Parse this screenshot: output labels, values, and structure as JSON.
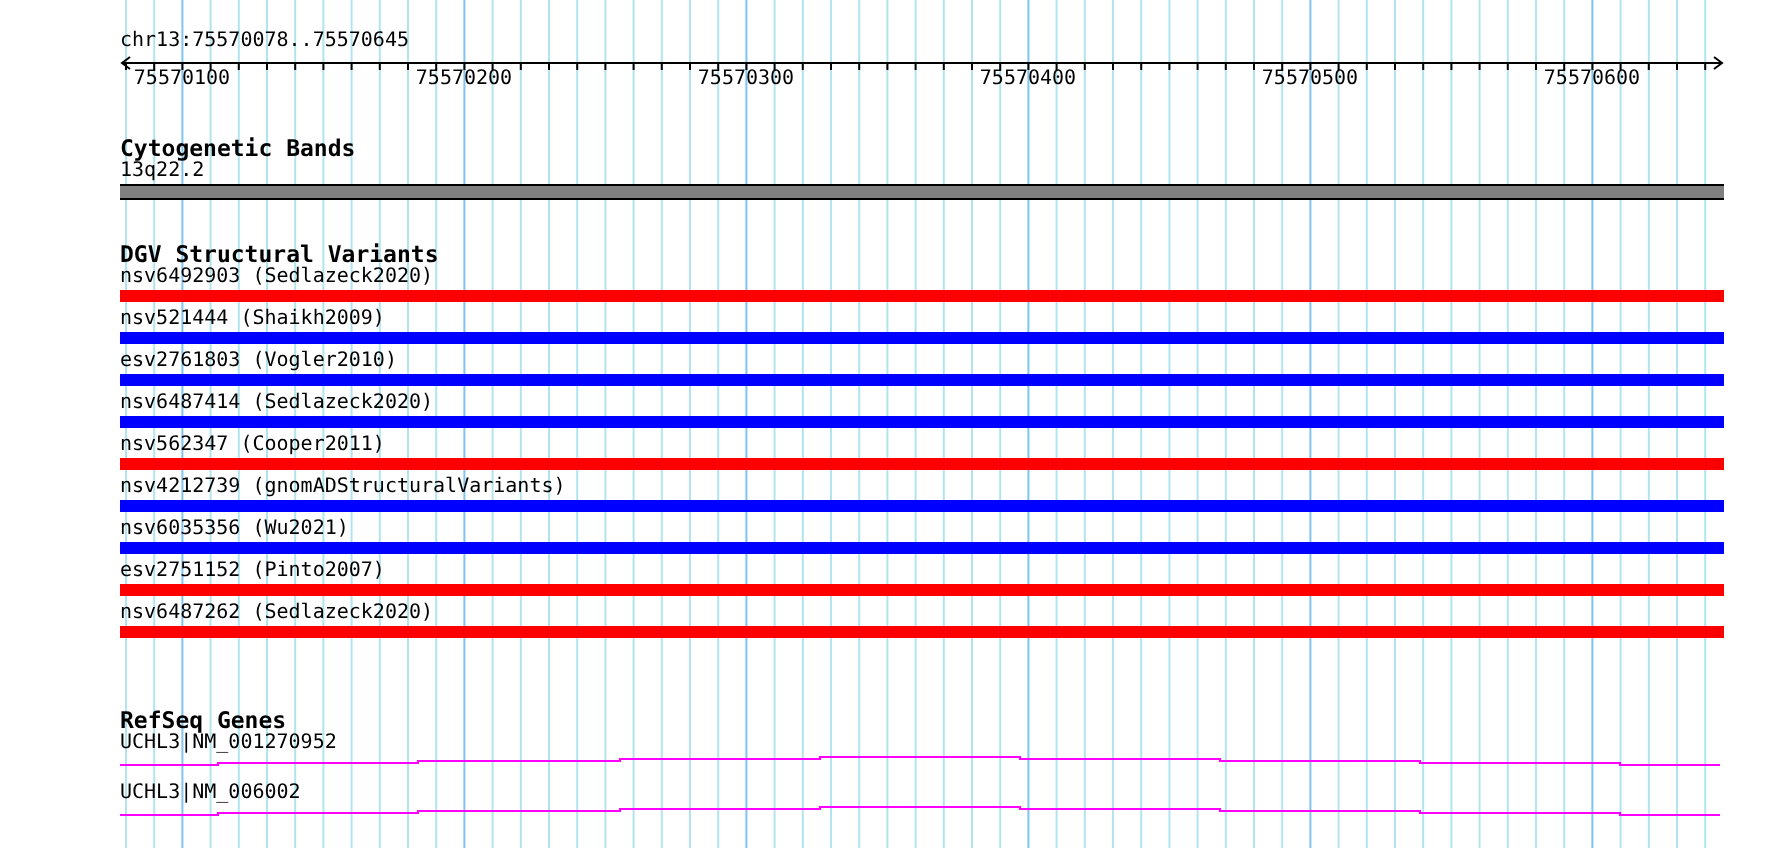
{
  "ruler": {
    "location": "chr13:75570078..75570645",
    "ticks": [
      "75570100",
      "75570200",
      "75570300",
      "75570400",
      "75570500",
      "75570600"
    ]
  },
  "cytogenetic_bands": {
    "title": "Cytogenetic Bands",
    "bands": [
      {
        "label": "13q22.2"
      }
    ]
  },
  "dgv_structural_variants": {
    "title": "DGV Structural Variants",
    "variants": [
      {
        "label": "nsv6492903 (Sedlazeck2020)",
        "color": "#ff0000"
      },
      {
        "label": "nsv521444 (Shaikh2009)",
        "color": "#0000ff"
      },
      {
        "label": "esv2761803 (Vogler2010)",
        "color": "#0000ff"
      },
      {
        "label": "nsv6487414 (Sedlazeck2020)",
        "color": "#0000ff"
      },
      {
        "label": "nsv562347 (Cooper2011)",
        "color": "#ff0000"
      },
      {
        "label": "nsv4212739 (gnomADStructuralVariants)",
        "color": "#0000ff"
      },
      {
        "label": "nsv6035356 (Wu2021)",
        "color": "#0000ff"
      },
      {
        "label": "esv2751152 (Pinto2007)",
        "color": "#ff0000"
      },
      {
        "label": "nsv6487262 (Sedlazeck2020)",
        "color": "#ff0000"
      }
    ]
  },
  "refseq_genes": {
    "title": "RefSeq Genes",
    "genes": [
      {
        "label": "UCHL3|NM_001270952"
      },
      {
        "label": "UCHL3|NM_006002"
      }
    ]
  }
}
